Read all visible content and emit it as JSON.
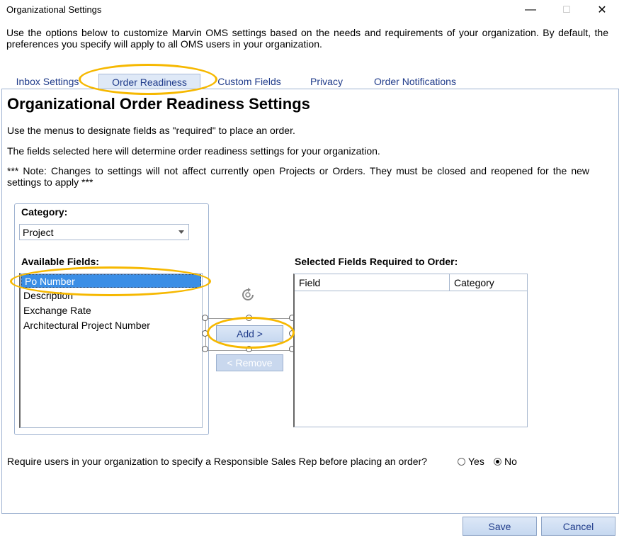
{
  "window": {
    "title": "Organizational Settings",
    "minimize": "—",
    "maximize": "☐",
    "close": "✕"
  },
  "intro": "Use the options below to customize Marvin OMS settings based on the needs and requirements of your organization. By default, the preferences you specify will apply to all OMS users in your organization.",
  "tabs": [
    {
      "label": "Inbox Settings"
    },
    {
      "label": "Order Readiness",
      "active": true
    },
    {
      "label": "Custom Fields"
    },
    {
      "label": "Privacy"
    },
    {
      "label": "Order Notifications"
    }
  ],
  "main": {
    "heading": "Organizational Order Readiness Settings",
    "line1": "Use the menus to designate fields as \"required\" to place an order.",
    "line2": "The fields selected here will determine order readiness settings for your organization.",
    "note": "*** Note: Changes to settings will not affect currently open Projects or Orders. They must be closed and reopened for the new settings to apply ***",
    "category_label": "Category:",
    "category_value": "Project",
    "available_label": "Available Fields:",
    "available_fields": [
      "Po Number",
      "Description",
      "Exchange Rate",
      "Architectural Project Number"
    ],
    "add_label": "Add >",
    "remove_label": "< Remove",
    "selected_label": "Selected Fields Required to Order:",
    "grid_columns": [
      "Field",
      "Category"
    ],
    "rep_question": "Require users in your organization to specify a Responsible Sales Rep before placing an order?",
    "rep_yes": "Yes",
    "rep_no": "No",
    "rep_selected": "No"
  },
  "footer": {
    "save_label": "Save",
    "cancel_label": "Cancel"
  },
  "colors": {
    "highlight": "#f6b800",
    "selection": "#3a8ee6",
    "tab_text": "#1f3b8a"
  }
}
